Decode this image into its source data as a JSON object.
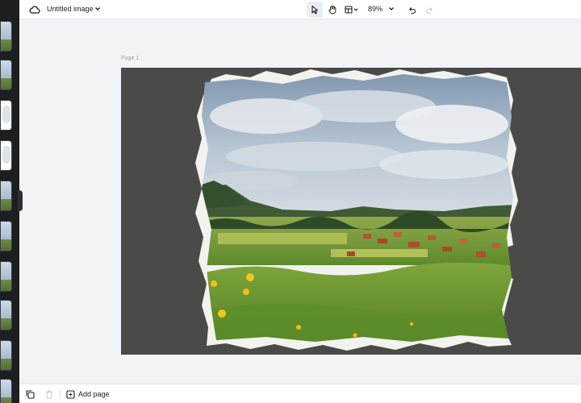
{
  "header": {
    "title": "Untitled image",
    "zoom": "89%",
    "tools": [
      "select-tool",
      "hand-tool",
      "layout-tool",
      "undo",
      "redo"
    ]
  },
  "canvas": {
    "page_label": "Page 1",
    "background_color": "#4a4b48"
  },
  "footer": {
    "add_page_label": "Add page"
  },
  "colors": {
    "accent": "#1d1d1f",
    "toolbar_bg": "#ffffff",
    "workspace_bg": "#f1f3f6",
    "strip_bg": "#1c1e22"
  },
  "icons": {
    "cloud": "cloud-icon",
    "duplicate": "duplicate-icon",
    "trash": "trash-icon",
    "add_page": "add-page-icon"
  }
}
